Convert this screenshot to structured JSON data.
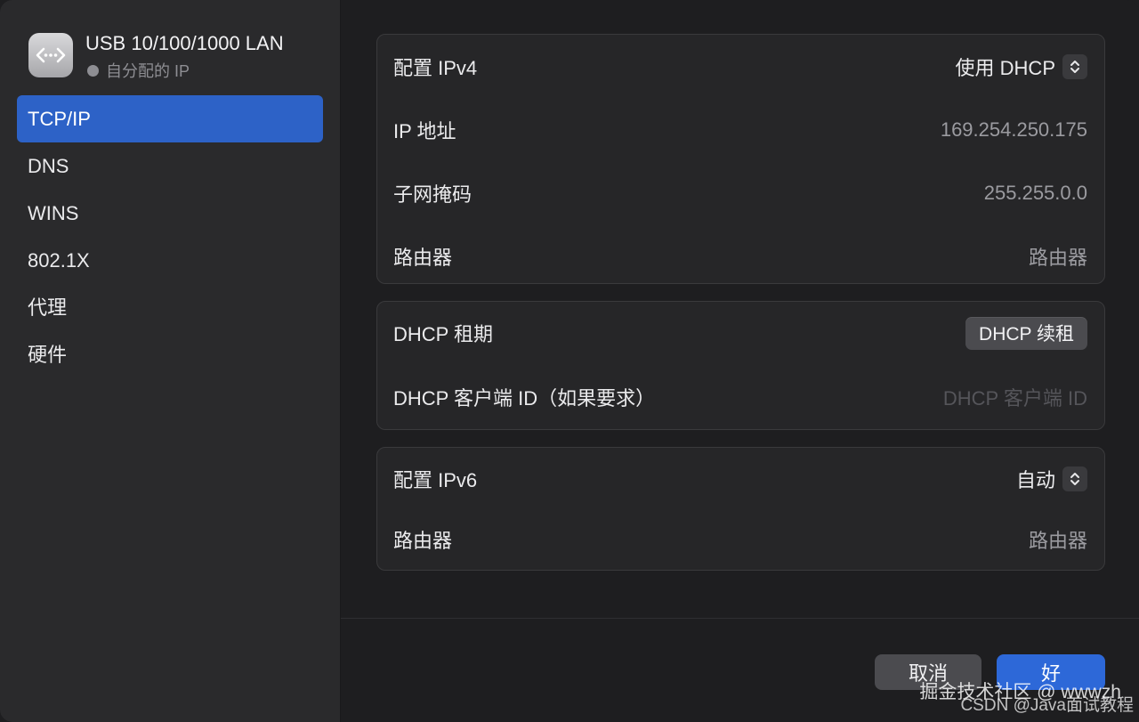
{
  "sidebar": {
    "interface_title": "USB 10/100/1000 LAN",
    "interface_status": "自分配的 IP",
    "icon": "network-interface-icon",
    "items": [
      {
        "label": "TCP/IP",
        "active": true
      },
      {
        "label": "DNS",
        "active": false
      },
      {
        "label": "WINS",
        "active": false
      },
      {
        "label": "802.1X",
        "active": false
      },
      {
        "label": "代理",
        "active": false
      },
      {
        "label": "硬件",
        "active": false
      }
    ]
  },
  "ipv4": {
    "configure_label": "配置 IPv4",
    "configure_value": "使用 DHCP",
    "ip_label": "IP 地址",
    "ip_value": "169.254.250.175",
    "subnet_label": "子网掩码",
    "subnet_value": "255.255.0.0",
    "router_label": "路由器",
    "router_value": "路由器"
  },
  "dhcp": {
    "lease_label": "DHCP 租期",
    "renew_button": "DHCP 续租",
    "client_id_label": "DHCP 客户端 ID（如果要求）",
    "client_id_placeholder": "DHCP 客户端 ID"
  },
  "ipv6": {
    "configure_label": "配置 IPv6",
    "configure_value": "自动",
    "router_label": "路由器",
    "router_value": "路由器"
  },
  "footer": {
    "cancel_label": "取消",
    "ok_label": "好"
  },
  "watermark": {
    "line1": "掘金技术社区 @ wwwzh",
    "line2": "CSDN @Java面试教程"
  },
  "colors": {
    "accent": "#2d62c7",
    "ok_button": "#2d68d8",
    "background": "#1e1e20",
    "sidebar": "#2a2a2c"
  }
}
